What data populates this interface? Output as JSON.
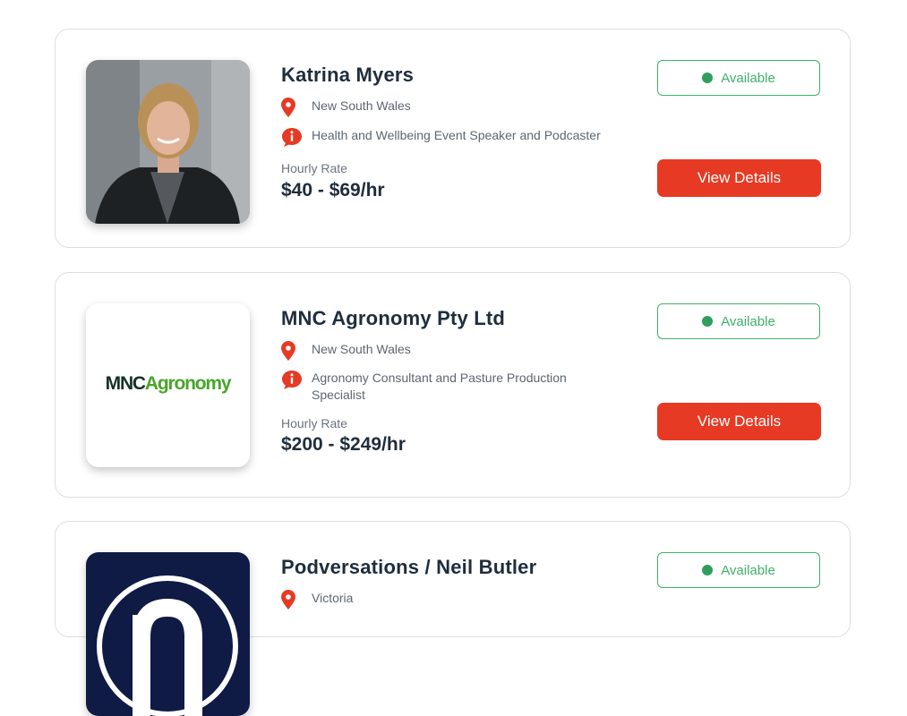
{
  "listings": [
    {
      "name": "Katrina Myers",
      "location": "New South Wales",
      "description": "Health and Wellbeing Event Speaker and Podcaster",
      "rate_label": "Hourly Rate",
      "rate": "$40 - $69/hr",
      "status": "Available",
      "button": "View Details"
    },
    {
      "name": "MNC Agronomy Pty Ltd",
      "location": "New South Wales",
      "description_line1": "Agronomy Consultant and Pasture Production",
      "description_line2": "Specialist",
      "rate_label": "Hourly Rate",
      "rate": "$200 - $249/hr",
      "status": "Available",
      "button": "View Details",
      "logo": "MNCAgronomy"
    },
    {
      "name": "Podversations / Neil Butler",
      "location": "Victoria",
      "status": "Available"
    }
  ],
  "colors": {
    "accent_red": "#e63a24",
    "available_green": "#3fb168",
    "heading": "#1f2d3d"
  },
  "icons": [
    "location-pin-icon",
    "info-bubble-icon"
  ]
}
